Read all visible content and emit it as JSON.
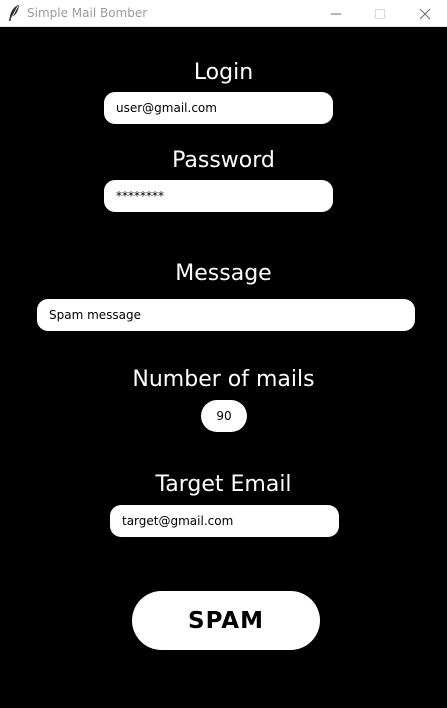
{
  "window": {
    "title": "Simple Mail Bomber",
    "app_icon": "feather-icon",
    "controls": {
      "minimize_icon": "minimize-icon",
      "maximize_icon": "maximize-icon",
      "close_icon": "close-icon"
    }
  },
  "form": {
    "login_label": "Login",
    "login_value": "user@gmail.com",
    "password_label": "Password",
    "password_value": "********",
    "message_label": "Message",
    "message_value": "Spam message",
    "count_label": "Number of mails",
    "count_value": "90",
    "target_label": "Target Email",
    "target_value": "target@gmail.com",
    "spam_button": "SPAM"
  },
  "colors": {
    "background": "#000000",
    "foreground": "#ffffff",
    "titlebar": "#ffffff",
    "title_text": "#9a9a9a"
  }
}
